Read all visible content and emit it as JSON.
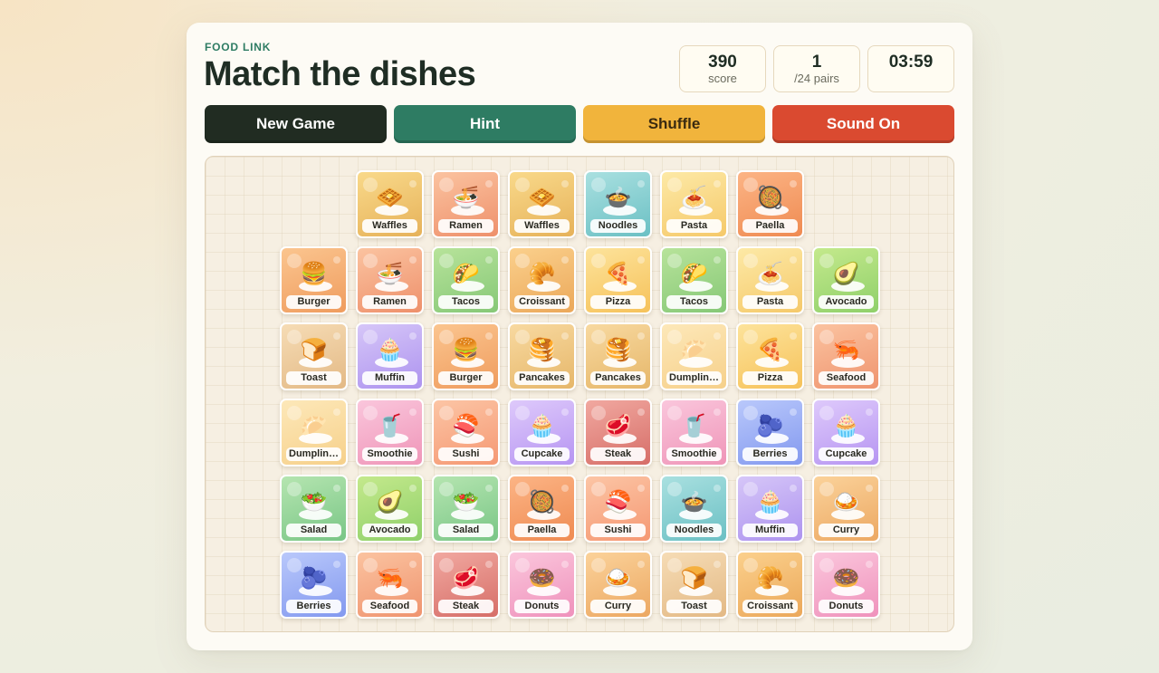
{
  "header": {
    "eyebrow": "FOOD LINK",
    "title": "Match the dishes"
  },
  "stats": {
    "score": {
      "value": "390",
      "label": "score"
    },
    "pairs": {
      "value": "1",
      "label": "/24 pairs"
    },
    "timer": {
      "value": "03:59"
    }
  },
  "buttons": {
    "new_game": "New Game",
    "hint": "Hint",
    "shuffle": "Shuffle",
    "sound": "Sound On"
  },
  "colors": {
    "new_game": "#212c22",
    "hint": "#2e7c63",
    "shuffle": "#f1b43c",
    "sound": "#da4a30"
  },
  "dishes": {
    "Waffles": {
      "icon": "🧇",
      "bg": [
        "#f9d98a",
        "#e6b25a"
      ]
    },
    "Ramen": {
      "icon": "🍜",
      "bg": [
        "#fbc3a0",
        "#ee906b"
      ]
    },
    "Noodles": {
      "icon": "🍲",
      "bg": [
        "#a9e0e0",
        "#6bc0c4"
      ]
    },
    "Pasta": {
      "icon": "🍝",
      "bg": [
        "#fde9a6",
        "#f5c96a"
      ]
    },
    "Paella": {
      "icon": "🥘",
      "bg": [
        "#fcb485",
        "#ef8b52"
      ]
    },
    "Burger": {
      "icon": "🍔",
      "bg": [
        "#fbc58f",
        "#ef9c5e"
      ]
    },
    "Tacos": {
      "icon": "🌮",
      "bg": [
        "#b7e39a",
        "#86c877"
      ]
    },
    "Croissant": {
      "icon": "🥐",
      "bg": [
        "#fbd08c",
        "#eba85a"
      ]
    },
    "Pizza": {
      "icon": "🍕",
      "bg": [
        "#fde39b",
        "#f6c25a"
      ]
    },
    "Avocado": {
      "icon": "🥑",
      "bg": [
        "#c4e98c",
        "#8fd06a"
      ]
    },
    "Toast": {
      "icon": "🍞",
      "bg": [
        "#f6dcb5",
        "#e3b985"
      ]
    },
    "Muffin": {
      "icon": "🧁",
      "bg": [
        "#d6c6f8",
        "#ad93ef"
      ]
    },
    "Pancakes": {
      "icon": "🥞",
      "bg": [
        "#f8d9a0",
        "#e6b76a"
      ]
    },
    "Dumplings": {
      "icon": "🥟",
      "bg": [
        "#fde8b9",
        "#f6d08a"
      ]
    },
    "Seafood": {
      "icon": "🦐",
      "bg": [
        "#fbc3a0",
        "#ef946f"
      ]
    },
    "Smoothie": {
      "icon": "🥤",
      "bg": [
        "#fac6dc",
        "#ef95b8"
      ]
    },
    "Sushi": {
      "icon": "🍣",
      "bg": [
        "#fcc5a5",
        "#f59873"
      ]
    },
    "Cupcake": {
      "icon": "🧁",
      "bg": [
        "#dec9fb",
        "#b695f2"
      ]
    },
    "Steak": {
      "icon": "🥩",
      "bg": [
        "#f1a8a0",
        "#d66e68"
      ]
    },
    "Berries": {
      "icon": "🫐",
      "bg": [
        "#b9c8fb",
        "#8399ef"
      ]
    },
    "Salad": {
      "icon": "🥗",
      "bg": [
        "#b5e5b0",
        "#79c686"
      ]
    },
    "Curry": {
      "icon": "🍛",
      "bg": [
        "#fbd29a",
        "#eca862"
      ]
    },
    "Donuts": {
      "icon": "🍩",
      "bg": [
        "#fbc6dc",
        "#ef92bc"
      ]
    }
  },
  "board": {
    "rows": [
      [
        null,
        "Waffles",
        "Ramen",
        "Waffles",
        "Noodles",
        "Pasta",
        "Paella",
        null
      ],
      [
        "Burger",
        "Ramen",
        "Tacos",
        "Croissant",
        "Pizza",
        "Tacos",
        "Pasta",
        "Avocado"
      ],
      [
        "Toast",
        "Muffin",
        "Burger",
        "Pancakes",
        "Pancakes",
        "Dumplings",
        "Pizza",
        "Seafood"
      ],
      [
        "Dumplings",
        "Smoothie",
        "Sushi",
        "Cupcake",
        "Steak",
        "Smoothie",
        "Berries",
        "Cupcake"
      ],
      [
        "Salad",
        "Avocado",
        "Salad",
        "Paella",
        "Sushi",
        "Noodles",
        "Muffin",
        "Curry"
      ],
      [
        "Berries",
        "Seafood",
        "Steak",
        "Donuts",
        "Curry",
        "Toast",
        "Croissant",
        "Donuts"
      ]
    ]
  }
}
